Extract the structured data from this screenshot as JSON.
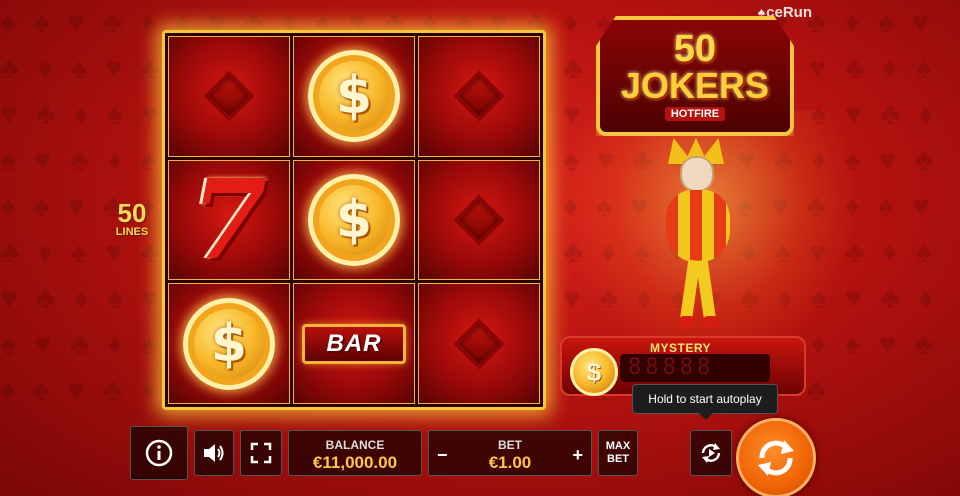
{
  "brand": {
    "name": "ceRun",
    "icon": "spade-icon"
  },
  "logo": {
    "number": "50",
    "title": "JOKERS",
    "subtitle": "HOTFIRE"
  },
  "lines": {
    "number": "50",
    "label": "LINES"
  },
  "reels": {
    "grid": [
      [
        "diamond",
        "coin",
        "diamond"
      ],
      [
        "seven",
        "coin",
        "diamond"
      ],
      [
        "coin",
        "bar",
        "diamond"
      ]
    ],
    "symbol_text": {
      "coin": "$",
      "seven": "7",
      "bar": "BAR"
    }
  },
  "mystery": {
    "label": "MYSTERY",
    "display": "88888"
  },
  "tooltip": {
    "text": "Hold to start autoplay"
  },
  "controls": {
    "info_icon": "info-icon",
    "sound_icon": "speaker-icon",
    "fullscreen_icon": "fullscreen-icon",
    "balance_label": "BALANCE",
    "balance_value": "€11,000.00",
    "bet_label": "BET",
    "bet_value": "€1.00",
    "bet_minus": "−",
    "bet_plus": "+",
    "max_bet_line1": "MAX",
    "max_bet_line2": "BET",
    "autoplay_icon": "autoplay-icon",
    "spin_icon": "spin-icon"
  },
  "colors": {
    "accent": "#f06405",
    "gold": "#f5c83c",
    "background": "#b5120f"
  }
}
